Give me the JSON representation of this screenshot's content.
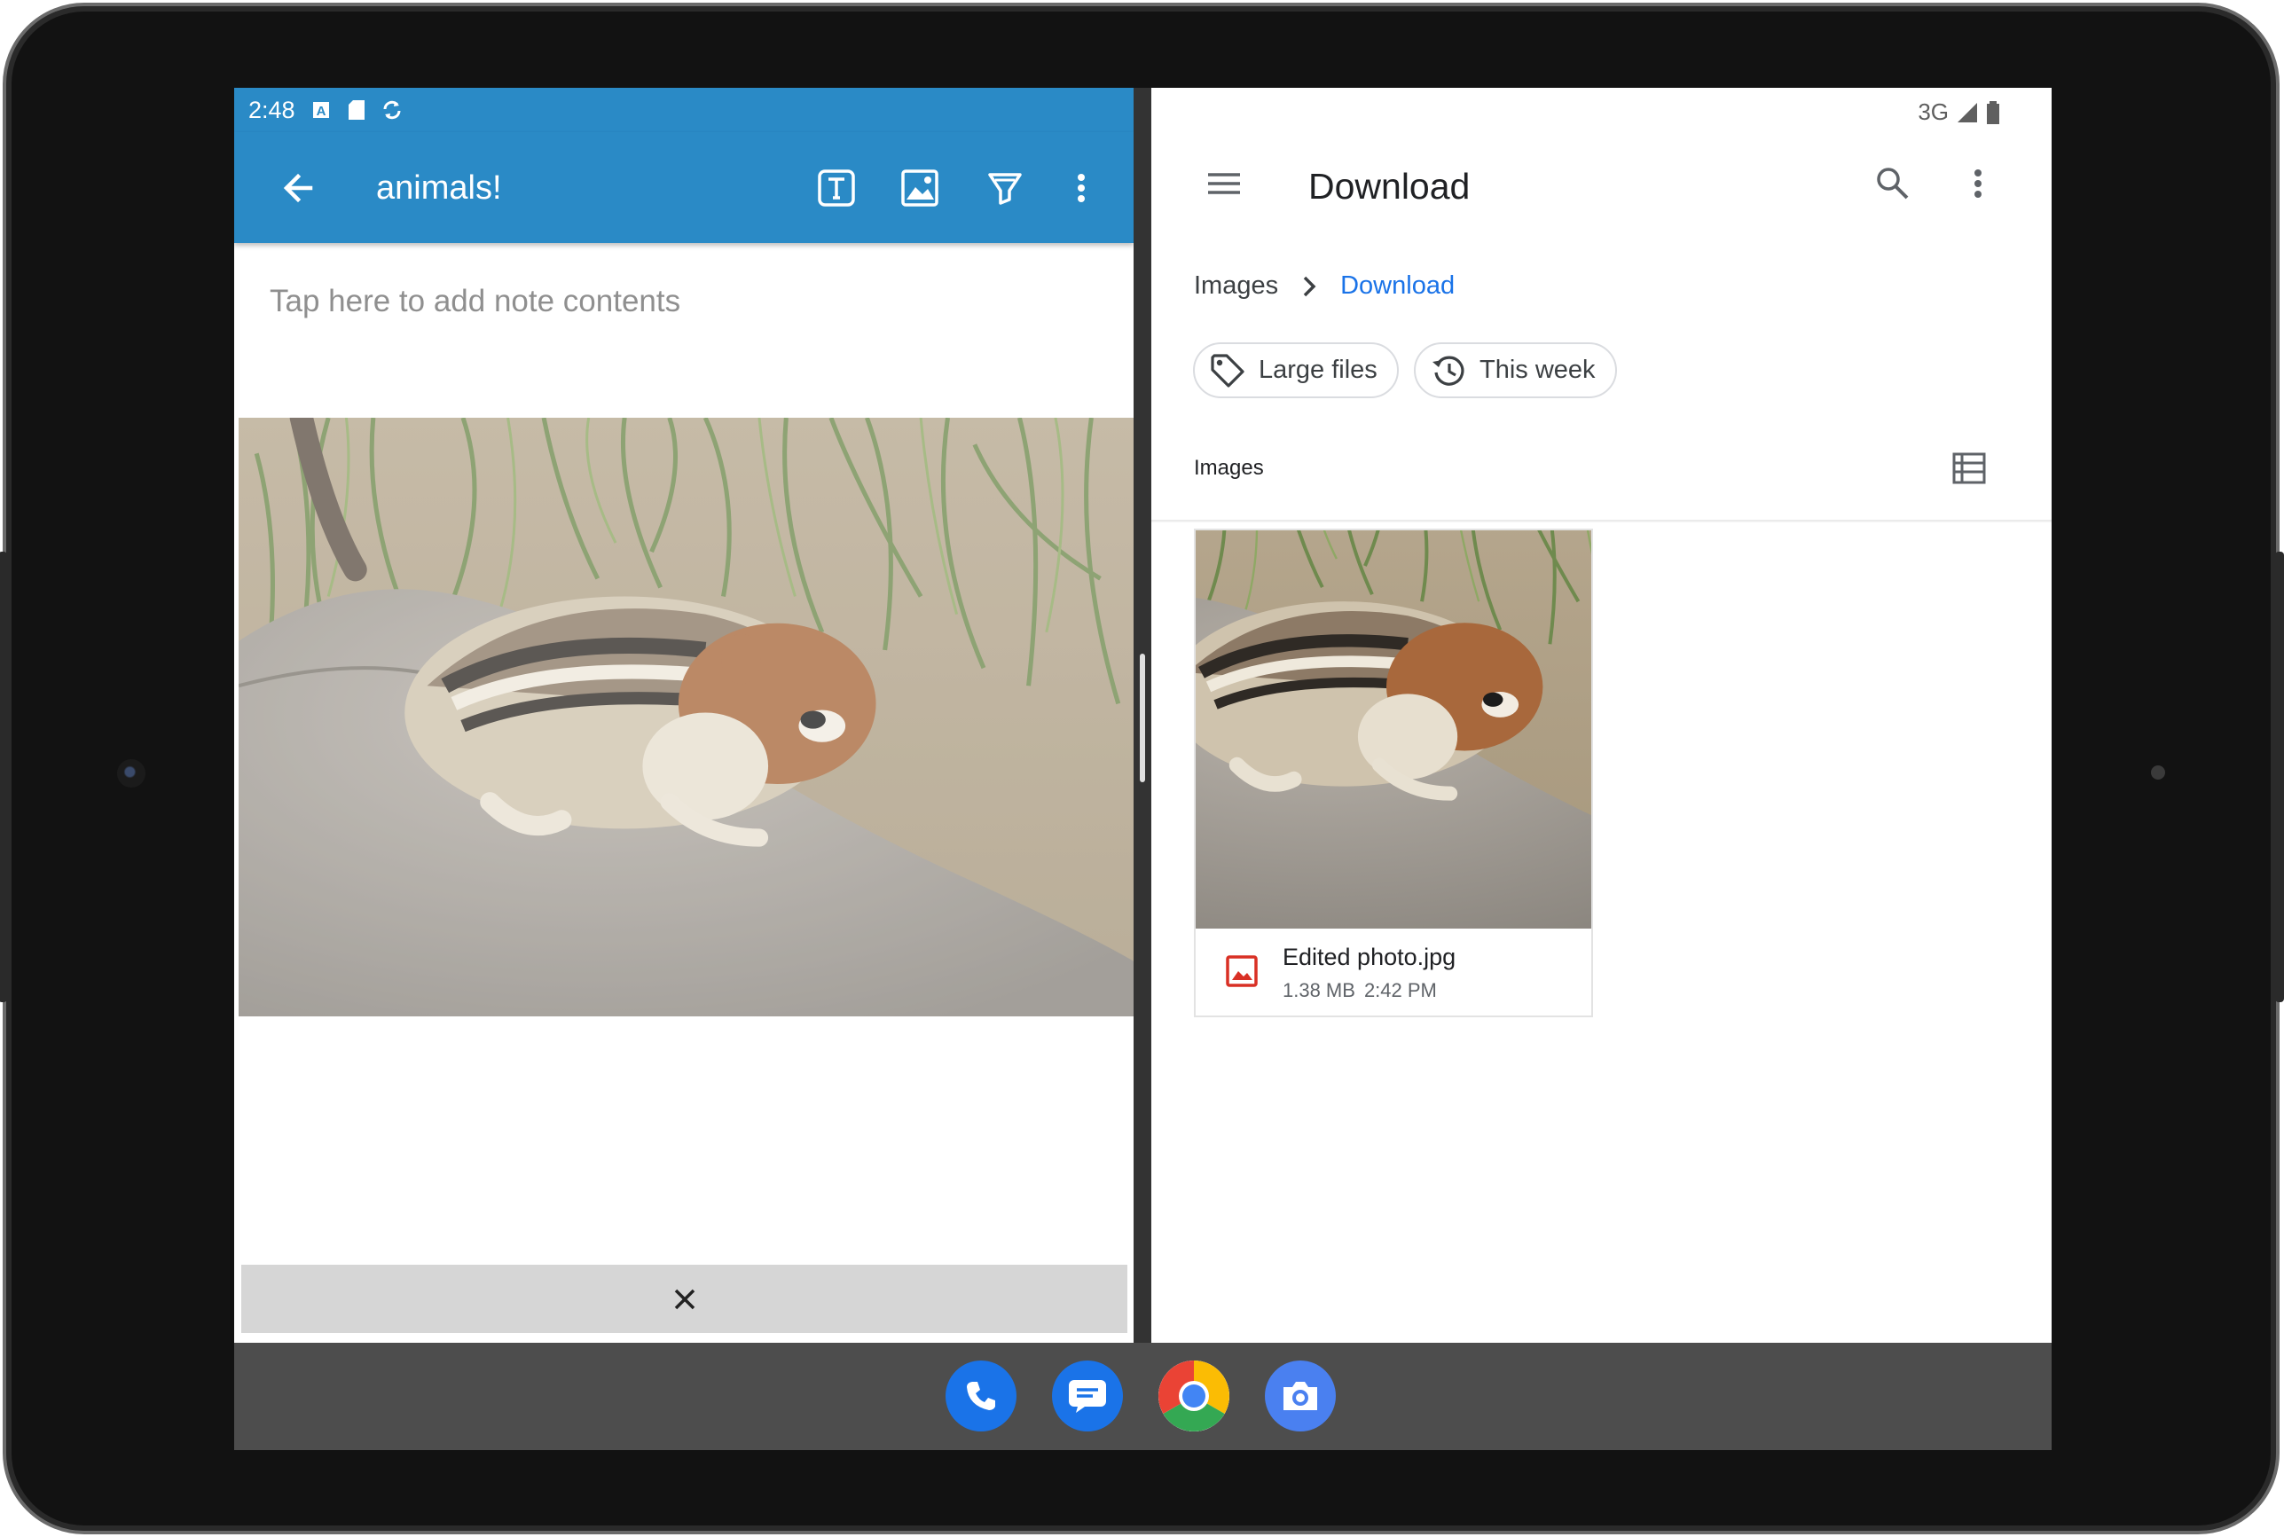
{
  "device": {
    "frame_color": "#121212"
  },
  "left_app": {
    "status_bar": {
      "time": "2:48",
      "icons": [
        "a-letter-icon",
        "sd-card-icon",
        "sync-icon"
      ]
    },
    "toolbar": {
      "back_icon": "arrow-back-icon",
      "title": "animals!",
      "actions": [
        "text-format-icon",
        "image-icon",
        "highlighter-icon",
        "more-vert-icon"
      ],
      "color": "#2a8ac6"
    },
    "note": {
      "placeholder": "Tap here to add note contents"
    },
    "image": {
      "subject": "chipmunk-on-rock"
    },
    "bottom_bar": {
      "close_icon": "close-icon"
    }
  },
  "right_app": {
    "status_bar": {
      "network": "3G"
    },
    "toolbar": {
      "menu_icon": "hamburger-menu-icon",
      "title": "Download",
      "actions": [
        "search-icon",
        "more-vert-icon"
      ]
    },
    "breadcrumb": {
      "root": "Images",
      "current": "Download",
      "accent": "#1a73e8"
    },
    "chips": [
      {
        "label": "Large files",
        "icon": "tag-icon"
      },
      {
        "label": "This week",
        "icon": "history-icon"
      }
    ],
    "section": {
      "label": "Images",
      "view_toggle_icon": "list-view-icon"
    },
    "files": [
      {
        "name": "Edited photo.jpg",
        "size": "1.38 MB",
        "time": "2:42 PM",
        "type_icon": "image-file-icon",
        "type_color": "#d93025"
      }
    ]
  },
  "dock": {
    "apps": [
      "phone-icon",
      "messages-icon",
      "chrome-icon",
      "camera-icon"
    ]
  }
}
